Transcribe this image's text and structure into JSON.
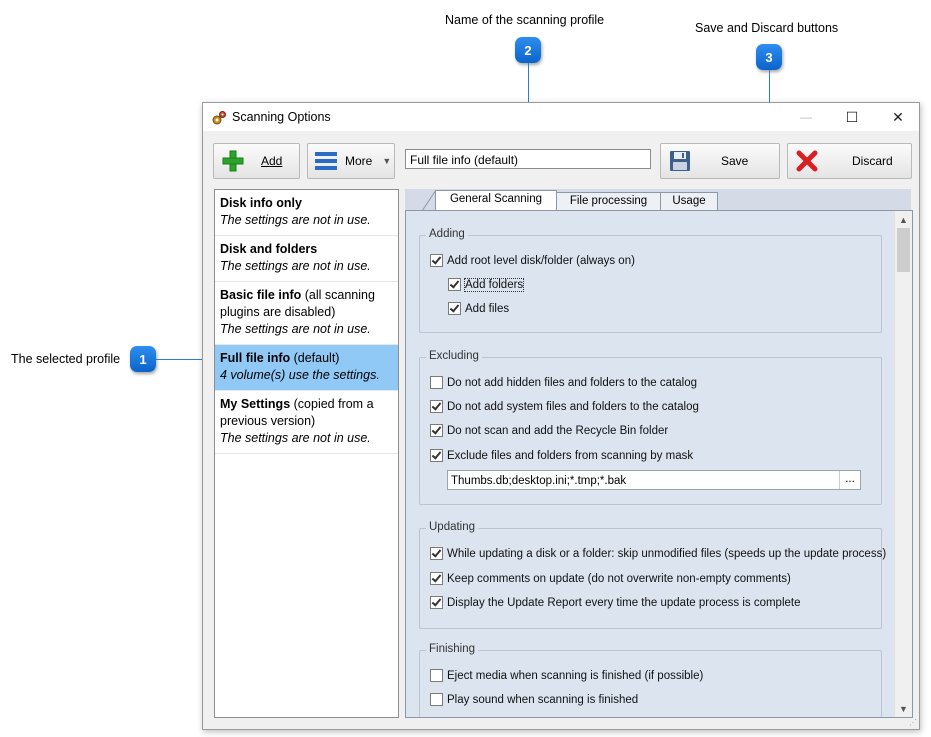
{
  "callouts": {
    "name_label": "Name of the scanning profile",
    "name_badge": "2",
    "save_label": "Save and Discard buttons",
    "save_badge": "3",
    "profile_label": "The selected profile",
    "profile_badge": "1"
  },
  "window": {
    "title": "Scanning Options",
    "minimize_glyph": "—",
    "maximize_glyph": "☐",
    "close_glyph": "✕"
  },
  "toolbar": {
    "add_label": "Add",
    "more_label": "More",
    "profile_name_value": "Full file info (default)",
    "save_label": "Save",
    "discard_label": "Discard"
  },
  "profiles": [
    {
      "name": "Disk info only",
      "note": "",
      "status": "The settings are not in use."
    },
    {
      "name": "Disk and folders",
      "note": "",
      "status": "The settings are not in use."
    },
    {
      "name": "Basic file info",
      "note": " (all scanning plugins are disabled)",
      "status": "The settings are not in use."
    },
    {
      "name": "Full file info",
      "note": " (default)",
      "status": "4 volume(s) use the settings."
    },
    {
      "name": "My Settings",
      "note": " (copied from a previous version)",
      "status": "The settings are not in use."
    }
  ],
  "tabs": [
    "General Scanning",
    "File processing",
    "Usage"
  ],
  "groups": {
    "adding": {
      "title": "Adding",
      "items": [
        "Add root level disk/folder (always on)",
        "Add folders",
        "Add files"
      ]
    },
    "excluding": {
      "title": "Excluding",
      "items": [
        "Do not add hidden files and folders to the catalog",
        "Do not add system files and folders to the catalog",
        "Do not scan and add the Recycle Bin folder",
        "Exclude files and folders from scanning by mask"
      ],
      "mask_value": "Thumbs.db;desktop.ini;*.tmp;*.bak",
      "mask_button": "..."
    },
    "updating": {
      "title": "Updating",
      "items": [
        "While updating a disk or a folder: skip unmodified files (speeds up the update process)",
        "Keep comments on update (do not overwrite non-empty comments)",
        "Display the Update Report every time the update process is complete"
      ]
    },
    "finishing": {
      "title": "Finishing",
      "items": [
        "Eject media when scanning is finished (if possible)",
        "Play sound when scanning is finished"
      ]
    }
  },
  "colors": {
    "callout_blue": "#1677e0",
    "selected_profile": "#90c8f6",
    "panel_bg": "#dbe4ef",
    "add_green": "#2aa52a",
    "discard_red": "#d92020"
  },
  "icons": {
    "add": "plus-icon",
    "more": "hamburger-icon",
    "save": "floppy-disk-icon",
    "discard": "red-x-icon",
    "title": "gears-icon"
  }
}
